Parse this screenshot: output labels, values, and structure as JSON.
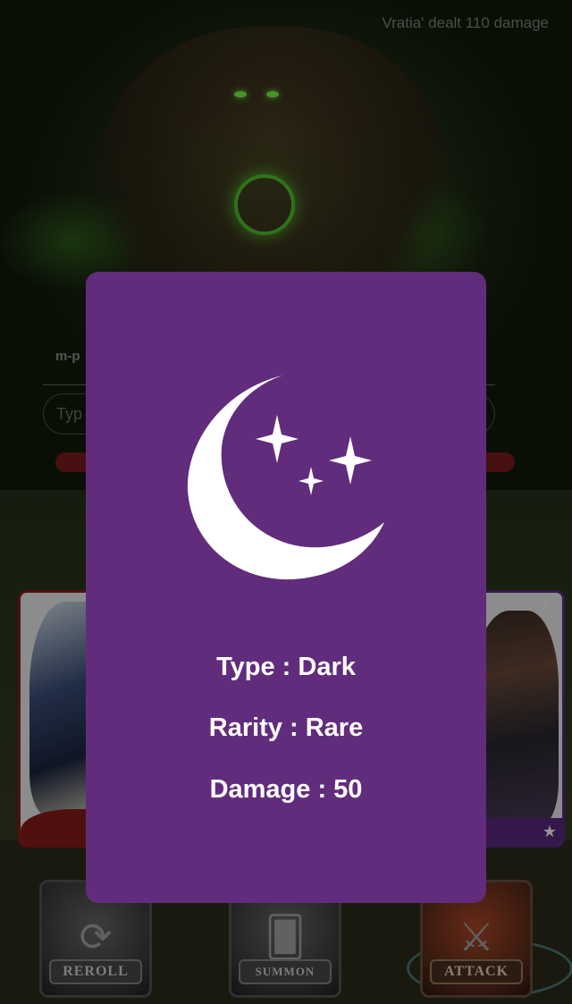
{
  "battle_log": {
    "message": "Vratia' dealt 110 damage"
  },
  "input": {
    "label": "m-p",
    "placeholder": "Typ"
  },
  "buttons": {
    "reroll": "REROLL",
    "summon": "SUMMON",
    "attack": "ATTACK"
  },
  "card": {
    "type_line": "Type : Dark",
    "rarity_line": "Rarity : Rare",
    "damage_line": "Damage : 50",
    "background_color": "#622c7c",
    "icon": "moon-stars-icon"
  },
  "colors": {
    "left_card_border": "#8a1d1d",
    "right_card_border": "#5b2a82"
  }
}
